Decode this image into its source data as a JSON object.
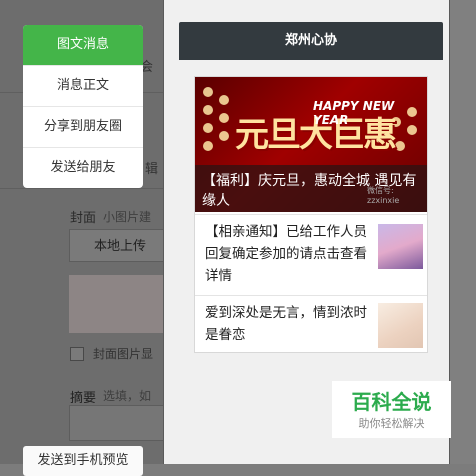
{
  "popup_menu": {
    "items": [
      {
        "label": "图文消息",
        "active": true
      },
      {
        "label": "消息正文",
        "active": false
      },
      {
        "label": "分享到朋友圈",
        "active": false
      },
      {
        "label": "发送给朋友",
        "active": false
      }
    ]
  },
  "editor": {
    "title_fragment": "会",
    "stitch_fragment": "辑",
    "cover_label": "封面",
    "cover_hint": "小图片建",
    "upload_button": "本地上传",
    "cover_show_in_body": "封面图片显",
    "summary_label": "摘要",
    "summary_hint": "选填，如",
    "send_preview_button": "发送到手机预览"
  },
  "preview": {
    "account_title": "郑州心协",
    "hero": {
      "banner_cn": "元旦大巨惠",
      "banner_en": "HAPPY NEW YEAR",
      "caption": "【福利】庆元旦，惠动全城 遇见有缘人",
      "watermark": "微信号: zzxinxie"
    },
    "articles": [
      {
        "title": "【相亲通知】已给工作人员回复确定参加的请点击查看详情"
      },
      {
        "title": "爱到深处是无言，情到浓时是眷恋"
      }
    ]
  },
  "watermark_logo": {
    "title": "百科全说",
    "subtitle": "助你轻松解决"
  },
  "colors": {
    "accent_green": "#44b549",
    "title_bar": "#333a3f",
    "logo_green": "#2cab4d"
  }
}
